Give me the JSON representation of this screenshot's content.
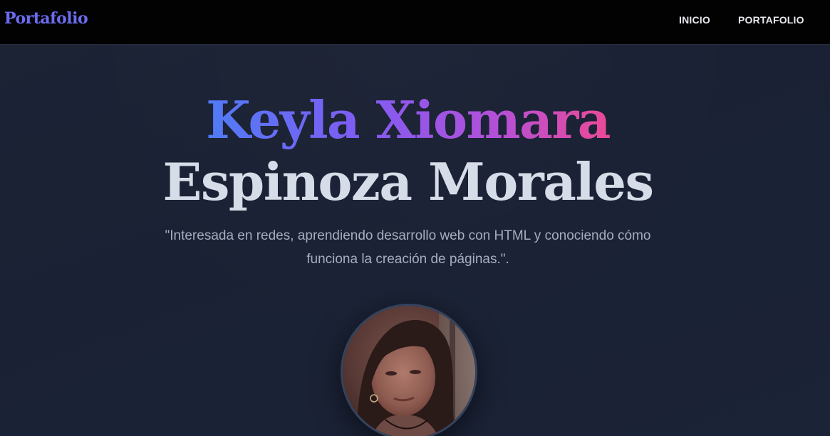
{
  "navbar": {
    "brand": "Portafolio",
    "links": [
      {
        "label": "INICIO"
      },
      {
        "label": "PORTAFOLIO"
      }
    ]
  },
  "hero": {
    "first_name": "Keyla Xiomara",
    "last_name": "Espinoza Morales",
    "tagline": "\"Interesada en redes, aprendiendo desarrollo web con HTML y conociendo cómo funciona la creación de páginas.\".",
    "avatar": "profile-photo"
  },
  "colors": {
    "navbar_bg": "#020203",
    "brand": "#6b6cf0",
    "hero_bg": "#1b2235",
    "name_gradient_start": "#4f7cf5",
    "name_gradient_mid": "#8b5cf6",
    "name_gradient_end": "#ec4899",
    "last_name": "#d6dde8",
    "tagline": "#a5aebe"
  }
}
